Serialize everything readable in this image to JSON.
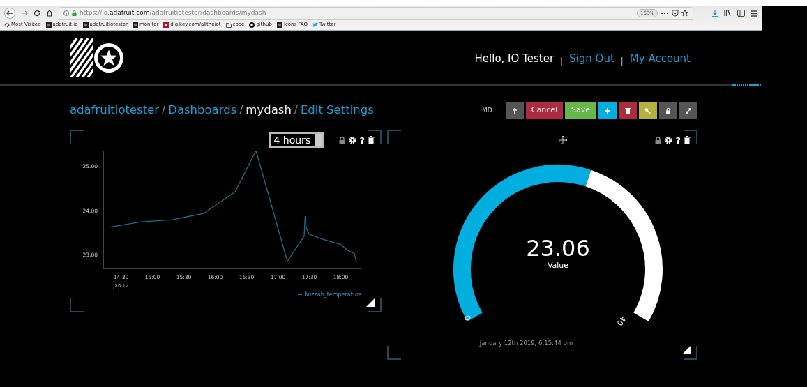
{
  "browser": {
    "url": "https://io.**adafruit.com**/adafruitiotester/dashboards/mydash",
    "zoom": "163%",
    "bookmarks": [
      {
        "kind": "gear",
        "text": "Most Visited"
      },
      {
        "kind": "site",
        "text": "adafruit.io"
      },
      {
        "kind": "site",
        "text": "adafruitiotester"
      },
      {
        "kind": "site",
        "text": "monitor"
      },
      {
        "kind": "digikey",
        "text": "digikey.com/alltheiot"
      },
      {
        "kind": "folder",
        "text": "code"
      },
      {
        "kind": "github",
        "text": "github"
      },
      {
        "kind": "site",
        "text": "Icons FAQ"
      },
      {
        "kind": "twitter",
        "text": "Twitter"
      }
    ]
  },
  "header": {
    "items": [
      {
        "kind": "text",
        "text": "Hello, IO Tester"
      },
      {
        "kind": "sep",
        "text": "|"
      },
      {
        "kind": "link",
        "text": "Sign Out"
      },
      {
        "kind": "sep",
        "text": "|"
      },
      {
        "kind": "link",
        "text": "My Account"
      }
    ]
  },
  "breadcrumb": {
    "items": [
      {
        "text": "adafruitiotester",
        "current": false
      },
      {
        "text": "Dashboards",
        "current": false
      },
      {
        "text": "mydash",
        "current": true
      },
      {
        "text": "Edit Settings",
        "current": false
      }
    ],
    "separators": [
      "/",
      "/",
      "/"
    ]
  },
  "toolbar": {
    "label": "MD",
    "text_buttons": [
      "Cancel",
      "Save"
    ]
  },
  "chart_widget": {
    "range": "4 hours",
    "help": "?",
    "chart_data": {
      "type": "line",
      "x": [
        859,
        888,
        919,
        949,
        979,
        999,
        1029,
        1045,
        1046,
        1047,
        1050,
        1063,
        1079,
        1088,
        1093,
        1095
      ],
      "series": [
        {
          "name": "huzzah_temperature",
          "color": "#1e6f8a",
          "values": [
            23.62,
            23.74,
            23.79,
            23.93,
            24.42,
            25.35,
            22.85,
            23.42,
            23.87,
            23.61,
            23.46,
            23.35,
            23.24,
            23.08,
            23.03,
            22.83
          ]
        }
      ],
      "xticks": [
        {
          "value": 870,
          "label": "14:30"
        },
        {
          "value": 900,
          "label": "15:00"
        },
        {
          "value": 930,
          "label": "15:30"
        },
        {
          "value": 960,
          "label": "16:00"
        },
        {
          "value": 990,
          "label": "16:30"
        },
        {
          "value": 1020,
          "label": "17:00"
        },
        {
          "value": 1050,
          "label": "17:30"
        },
        {
          "value": 1080,
          "label": "18:00"
        }
      ],
      "yticks": [
        {
          "value": 23,
          "label": "23.00"
        },
        {
          "value": 24,
          "label": "24.00"
        },
        {
          "value": 25,
          "label": "25.00"
        }
      ],
      "xlim": [
        853,
        1099
      ],
      "ylim": [
        22.69,
        25.35
      ],
      "annotations": [
        "Jan 12"
      ]
    }
  },
  "gauge_widget": {
    "help": "?",
    "value": "23.06",
    "caption": "Value",
    "min": "0",
    "max": "40",
    "timestamp": "January 12th 2019, 6:15:44 pm"
  }
}
